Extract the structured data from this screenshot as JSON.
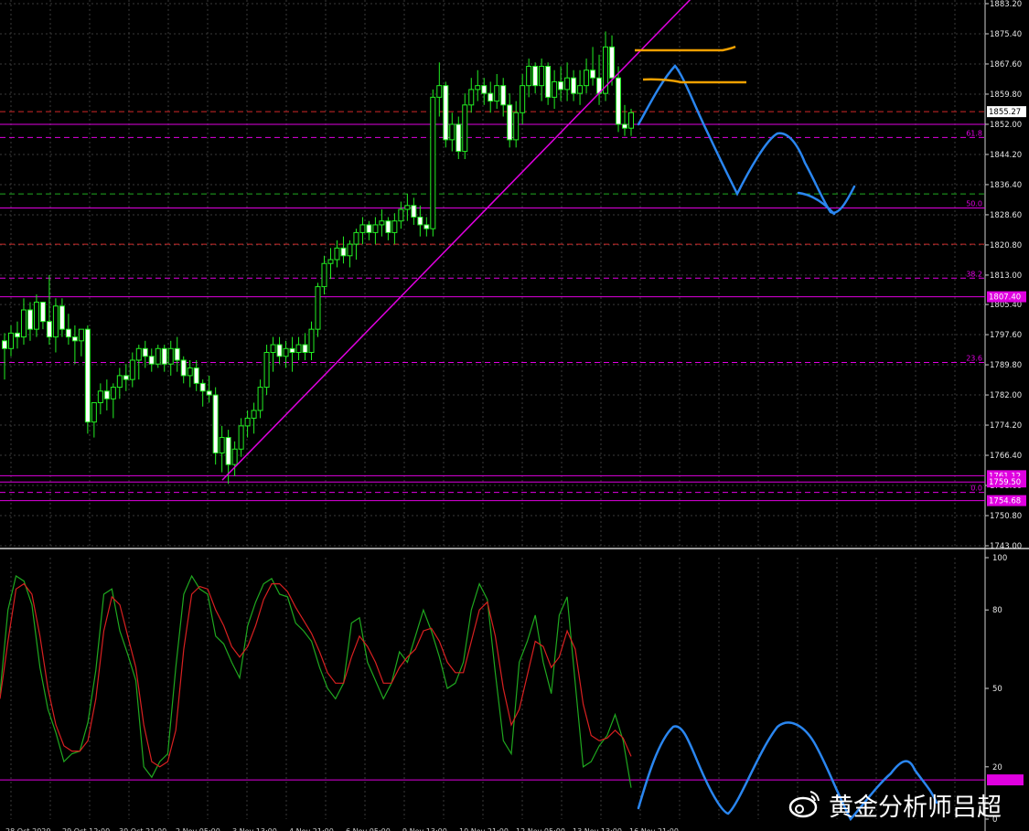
{
  "chart_data": [
    {
      "type": "candlestick",
      "title": "",
      "ylim": [
        1743.0,
        1883.2
      ],
      "y_ticks": [
        "1883.20",
        "1875.40",
        "1867.60",
        "1859.80",
        "1852.00",
        "1844.20",
        "1836.40",
        "1828.60",
        "1820.80",
        "1813.00",
        "1805.40",
        "1797.60",
        "1789.80",
        "1782.00",
        "1774.20",
        "1766.40",
        "1758.60",
        "1750.80",
        "1743.00"
      ],
      "grid": true,
      "candles": [
        [
          1796,
          1798,
          1786,
          1794
        ],
        [
          1794,
          1800,
          1792,
          1798
        ],
        [
          1798,
          1801,
          1794,
          1797
        ],
        [
          1797,
          1807,
          1795,
          1804
        ],
        [
          1804,
          1806,
          1796,
          1799
        ],
        [
          1799,
          1808,
          1797,
          1806
        ],
        [
          1806,
          1806,
          1799,
          1801
        ],
        [
          1801,
          1813,
          1795,
          1797
        ],
        [
          1797,
          1807,
          1793,
          1805
        ],
        [
          1805,
          1807,
          1797,
          1799
        ],
        [
          1799,
          1803,
          1795,
          1797
        ],
        [
          1797,
          1800,
          1790,
          1796
        ],
        [
          1796,
          1799,
          1792,
          1799
        ],
        [
          1799,
          1800,
          1772,
          1775
        ],
        [
          1775,
          1780,
          1771,
          1780
        ],
        [
          1780,
          1785,
          1777,
          1783
        ],
        [
          1783,
          1786,
          1778,
          1781
        ],
        [
          1781,
          1785,
          1776,
          1784
        ],
        [
          1784,
          1789,
          1781,
          1787
        ],
        [
          1787,
          1790,
          1783,
          1786
        ],
        [
          1786,
          1793,
          1784,
          1791
        ],
        [
          1791,
          1795,
          1786,
          1794
        ],
        [
          1794,
          1796,
          1789,
          1792
        ],
        [
          1792,
          1794,
          1788,
          1790
        ],
        [
          1790,
          1795,
          1789,
          1794
        ],
        [
          1794,
          1795,
          1788,
          1790
        ],
        [
          1790,
          1796,
          1787,
          1794
        ],
        [
          1794,
          1797,
          1788,
          1791
        ],
        [
          1791,
          1792,
          1785,
          1787
        ],
        [
          1787,
          1791,
          1784,
          1789
        ],
        [
          1789,
          1791,
          1783,
          1785
        ],
        [
          1785,
          1786,
          1779,
          1783
        ],
        [
          1783,
          1787,
          1780,
          1782
        ],
        [
          1782,
          1784,
          1764,
          1767
        ],
        [
          1767,
          1774,
          1762,
          1771
        ],
        [
          1771,
          1773,
          1759,
          1764
        ],
        [
          1764,
          1770,
          1761,
          1768
        ],
        [
          1768,
          1776,
          1766,
          1774
        ],
        [
          1774,
          1778,
          1771,
          1776
        ],
        [
          1776,
          1780,
          1772,
          1778
        ],
        [
          1778,
          1786,
          1776,
          1784
        ],
        [
          1784,
          1795,
          1782,
          1793
        ],
        [
          1793,
          1797,
          1788,
          1795
        ],
        [
          1795,
          1797,
          1790,
          1792
        ],
        [
          1792,
          1796,
          1789,
          1794
        ],
        [
          1794,
          1797,
          1788,
          1793
        ],
        [
          1793,
          1797,
          1791,
          1795
        ],
        [
          1795,
          1798,
          1791,
          1793
        ],
        [
          1793,
          1801,
          1791,
          1799
        ],
        [
          1799,
          1811,
          1797,
          1810
        ],
        [
          1810,
          1818,
          1808,
          1816
        ],
        [
          1816,
          1820,
          1812,
          1817
        ],
        [
          1817,
          1822,
          1815,
          1820
        ],
        [
          1820,
          1823,
          1816,
          1818
        ],
        [
          1818,
          1822,
          1815,
          1821
        ],
        [
          1821,
          1825,
          1817,
          1824
        ],
        [
          1824,
          1828,
          1821,
          1826
        ],
        [
          1826,
          1827,
          1822,
          1824
        ],
        [
          1824,
          1828,
          1821,
          1826
        ],
        [
          1826,
          1830,
          1823,
          1827
        ],
        [
          1827,
          1828,
          1822,
          1824
        ],
        [
          1824,
          1829,
          1821,
          1827
        ],
        [
          1827,
          1832,
          1825,
          1830
        ],
        [
          1830,
          1834,
          1827,
          1831
        ],
        [
          1831,
          1833,
          1826,
          1828
        ],
        [
          1828,
          1831,
          1823,
          1826
        ],
        [
          1826,
          1828,
          1823,
          1825
        ],
        [
          1825,
          1861,
          1823,
          1859
        ],
        [
          1859,
          1868,
          1854,
          1862
        ],
        [
          1862,
          1863,
          1846,
          1848
        ],
        [
          1848,
          1855,
          1845,
          1852
        ],
        [
          1852,
          1854,
          1843,
          1845
        ],
        [
          1845,
          1860,
          1843,
          1857
        ],
        [
          1857,
          1864,
          1855,
          1861
        ],
        [
          1861,
          1866,
          1858,
          1862
        ],
        [
          1862,
          1864,
          1857,
          1860
        ],
        [
          1860,
          1863,
          1855,
          1858
        ],
        [
          1858,
          1865,
          1856,
          1862
        ],
        [
          1862,
          1864,
          1854,
          1857
        ],
        [
          1857,
          1860,
          1846,
          1848
        ],
        [
          1848,
          1858,
          1846,
          1855
        ],
        [
          1855,
          1865,
          1852,
          1862
        ],
        [
          1862,
          1869,
          1859,
          1867
        ],
        [
          1867,
          1868,
          1860,
          1862
        ],
        [
          1862,
          1869,
          1858,
          1867
        ],
        [
          1867,
          1868,
          1857,
          1859
        ],
        [
          1859,
          1866,
          1856,
          1863
        ],
        [
          1863,
          1867,
          1858,
          1861
        ],
        [
          1861,
          1868,
          1858,
          1864
        ],
        [
          1864,
          1866,
          1858,
          1860
        ],
        [
          1860,
          1866,
          1857,
          1862
        ],
        [
          1862,
          1869,
          1860,
          1866
        ],
        [
          1866,
          1872,
          1862,
          1864
        ],
        [
          1864,
          1870,
          1857,
          1860
        ],
        [
          1860,
          1876,
          1858,
          1872
        ],
        [
          1872,
          1875,
          1862,
          1864
        ],
        [
          1864,
          1867,
          1850,
          1852
        ],
        [
          1852,
          1857,
          1849,
          1851
        ],
        [
          1851,
          1856,
          1849,
          1855
        ]
      ],
      "horizontal_lines": [
        {
          "price": 1855.27,
          "style": "dashed",
          "color": "#d02828"
        },
        {
          "price": 1852.0,
          "style": "solid",
          "color": "#e000e0"
        },
        {
          "price": 1848.6,
          "style": "dashed",
          "color": "#e000e0",
          "label": "61.8"
        },
        {
          "price": 1834.0,
          "style": "dashed",
          "color": "#22aa22"
        },
        {
          "price": 1830.35,
          "style": "solid",
          "color": "#e000e0",
          "label": "50.0"
        },
        {
          "price": 1821.0,
          "style": "dashed",
          "color": "#d02828"
        },
        {
          "price": 1812.2,
          "style": "dashed",
          "color": "#e000e0",
          "label": "38.2"
        },
        {
          "price": 1807.4,
          "style": "solid",
          "color": "#e000e0"
        },
        {
          "price": 1790.4,
          "style": "dashed",
          "color": "#e000e0",
          "label": "23.6"
        },
        {
          "price": 1761.12,
          "style": "solid",
          "color": "#e000e0"
        },
        {
          "price": 1759.5,
          "style": "solid",
          "color": "#e000e0"
        },
        {
          "price": 1756.8,
          "style": "dashed",
          "color": "#e000e0",
          "label": "0.0"
        },
        {
          "price": 1754.68,
          "style": "solid",
          "color": "#e000e0"
        }
      ],
      "price_labels": [
        {
          "price": 1855.27,
          "text": "1855.27",
          "bg": "#ffffff",
          "fg": "#000000"
        },
        {
          "price": 1807.4,
          "text": "1807.40",
          "bg": "#e000e0",
          "fg": "#ffffff"
        },
        {
          "price": 1761.12,
          "text": "1761.12",
          "bg": "#e000e0",
          "fg": "#ffffff"
        },
        {
          "price": 1759.5,
          "text": "1759.50",
          "bg": "#e000e0",
          "fg": "#ffffff"
        },
        {
          "price": 1754.68,
          "text": "1754.68",
          "bg": "#e000e0",
          "fg": "#ffffff"
        }
      ],
      "trendline": {
        "from": [
          0,
          1760
        ],
        "to": [
          114,
          1895
        ],
        "color": "#e000e0"
      }
    },
    {
      "type": "line",
      "title": "",
      "ylim": [
        0,
        100
      ],
      "y_ticks": [
        "100",
        "80",
        "50",
        "20",
        "0"
      ],
      "level_line": 15,
      "series": [
        {
          "color": "#1fa81f",
          "values": [
            48,
            80,
            93,
            91,
            82,
            58,
            42,
            33,
            22,
            25,
            26,
            37,
            57,
            86,
            88,
            72,
            63,
            53,
            20,
            16,
            22,
            25,
            58,
            86,
            93,
            88,
            86,
            70,
            67,
            60,
            54,
            74,
            83,
            90,
            92,
            86,
            85,
            75,
            72,
            68,
            58,
            50,
            46,
            52,
            75,
            77,
            60,
            53,
            46,
            52,
            64,
            60,
            70,
            80,
            72,
            62,
            50,
            52,
            60,
            80,
            90,
            84,
            56,
            30,
            25,
            60,
            68,
            78,
            60,
            48,
            78,
            85,
            52,
            20,
            22,
            28,
            32,
            40,
            30,
            12
          ]
        },
        {
          "color": "#d82020",
          "values": [
            46,
            68,
            88,
            90,
            86,
            70,
            50,
            36,
            28,
            26,
            26,
            30,
            46,
            72,
            85,
            82,
            70,
            58,
            36,
            22,
            20,
            22,
            34,
            65,
            86,
            89,
            88,
            80,
            74,
            66,
            62,
            66,
            74,
            84,
            90,
            90,
            87,
            81,
            76,
            71,
            64,
            56,
            52,
            52,
            62,
            70,
            66,
            60,
            52,
            52,
            58,
            62,
            65,
            72,
            73,
            68,
            60,
            56,
            56,
            68,
            80,
            83,
            70,
            50,
            36,
            42,
            55,
            68,
            66,
            58,
            62,
            72,
            65,
            44,
            32,
            30,
            31,
            34,
            31,
            24
          ]
        }
      ]
    }
  ],
  "annotations": {
    "projection_color": "#2a86f0",
    "orange_lines_color": "#f0a000"
  },
  "x_labels": [
    "28 Oct 2020",
    "29 Oct 12:00",
    "30 Oct 21:00",
    "2 Nov 05:00",
    "3 Nov 13:00",
    "4 Nov 21:00",
    "6 Nov 05:00",
    "9 Nov 13:00",
    "10 Nov 21:00",
    "12 Nov 05:00",
    "13 Nov 13:00",
    "16 Nov 21:00"
  ],
  "watermark": "黄金分析师吕超"
}
